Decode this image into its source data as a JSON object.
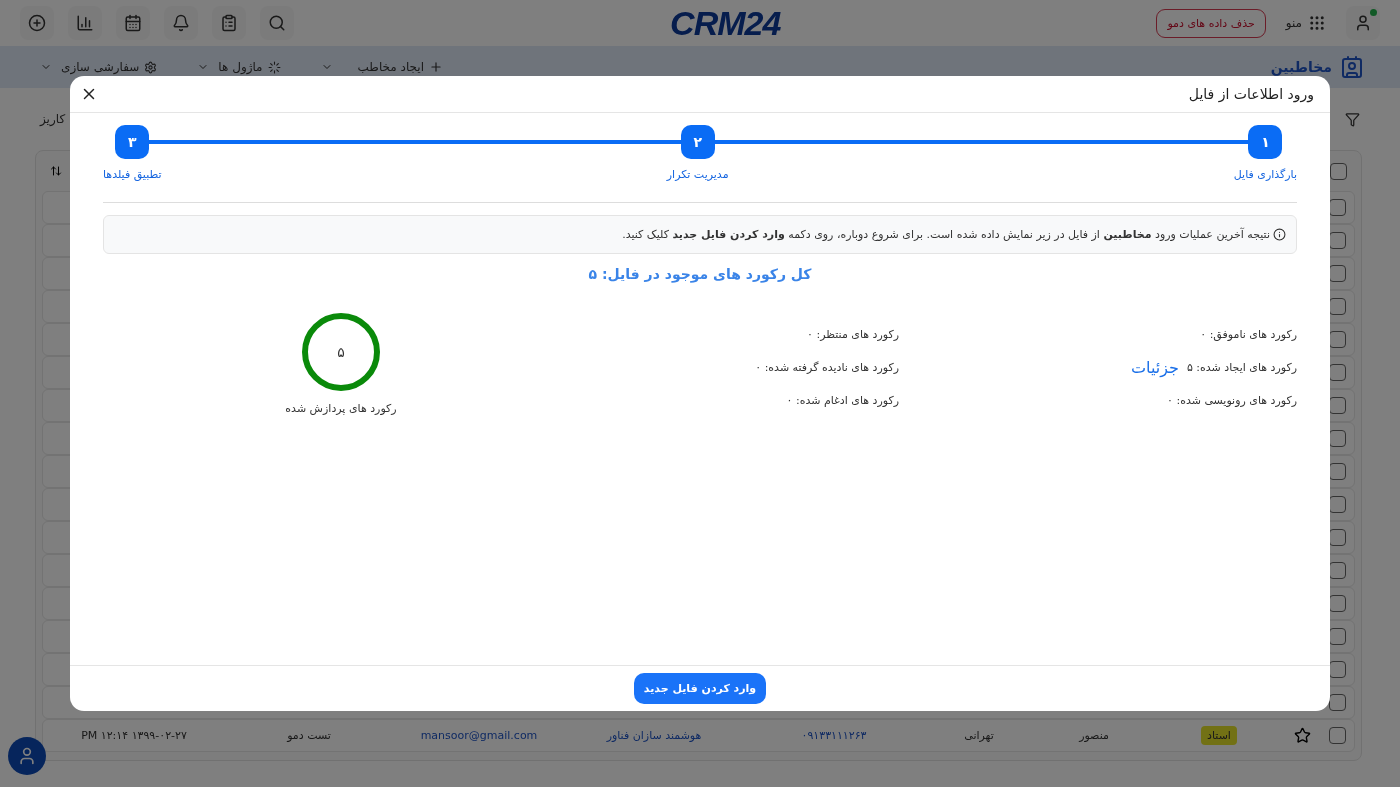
{
  "top_bar": {
    "logo": "CRM24",
    "menu_label": "منو",
    "demo_button": "حذف داده های دمو",
    "online": true
  },
  "sub_bar": {
    "title": "مخاطبین",
    "actions": [
      "ایجاد مخاطب",
      "ماژول ها",
      "سفارشی سازی"
    ]
  },
  "filter_row": {
    "text": "کاریز"
  },
  "table": {
    "header_checked": false,
    "rows": [
      {
        "checked": false
      },
      {
        "checked": false
      },
      {
        "checked": false
      },
      {
        "checked": false
      },
      {
        "checked": false
      },
      {
        "checked": false
      },
      {
        "checked": false
      },
      {
        "checked": false
      },
      {
        "checked": false
      },
      {
        "checked": false
      },
      {
        "checked": false
      },
      {
        "checked": false
      },
      {
        "checked": false
      },
      {
        "checked": false
      },
      {
        "checked": false
      },
      {
        "checked": false
      },
      {
        "checked": false,
        "starred": false,
        "tag": "استاد",
        "first_name": "منصور",
        "last_name": "تهرانی",
        "phone": "۰۹۱۳۳۱۱۱۲۶۳",
        "company": "هوشمند سازان فناور",
        "email": "mansoor@gmail.com",
        "owner": "تست دمو",
        "date": "۱۳۹۹-۰۲-۲۷ ۱۲:۱۴ PM"
      }
    ]
  },
  "dialog": {
    "title": "ورود اطلاعات از فایل",
    "steps": [
      {
        "number": "۱",
        "label": "بارگذاری فایل"
      },
      {
        "number": "۲",
        "label": "مدیریت تکرار"
      },
      {
        "number": "۳",
        "label": "تطبیق فیلدها"
      }
    ],
    "notice": "نتیجه آخرین عملیات ورود **مخاطبین** از فایل در زیر نمایش داده شده است. برای شروع دوباره، روی دکمه **وارد کردن فایل جدید** کلیک کنید.",
    "total": "کل رکورد های موجود در فایل: ۵",
    "stats": [
      {
        "text": "رکورد های ناموفق: ۰"
      },
      {
        "text": "رکورد های منتظر: ۰"
      },
      {
        "text": "رکورد های ایجاد شده: ۵",
        "link": "جزئیات"
      },
      {
        "text": "رکورد های نادیده گرفته شده: ۰"
      },
      {
        "text": "رکورد های رونویسی شده: ۰"
      },
      {
        "text": "رکورد های ادغام شده: ۰"
      }
    ],
    "processed": {
      "value": "۵",
      "label": "رکورد های پردازش شده",
      "level": 1
    },
    "button": "وارد کردن فایل جدید"
  }
}
